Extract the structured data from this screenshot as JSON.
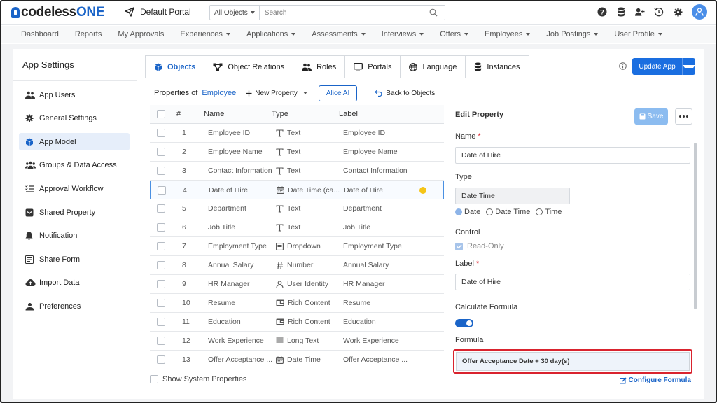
{
  "brand": {
    "prefix": "codeless",
    "suffix": "ONE"
  },
  "portal": {
    "name": "Default Portal"
  },
  "search": {
    "scope": "All Objects",
    "placeholder": "Search"
  },
  "topicons": [
    "help-icon",
    "database-icon",
    "user-add-icon",
    "history-icon",
    "gear-icon",
    "user-avatar-icon"
  ],
  "menu": [
    {
      "label": "Dashboard",
      "dropdown": false
    },
    {
      "label": "Reports",
      "dropdown": false
    },
    {
      "label": "My Approvals",
      "dropdown": false
    },
    {
      "label": "Experiences",
      "dropdown": true
    },
    {
      "label": "Applications",
      "dropdown": true
    },
    {
      "label": "Assessments",
      "dropdown": true
    },
    {
      "label": "Interviews",
      "dropdown": true
    },
    {
      "label": "Offers",
      "dropdown": true
    },
    {
      "label": "Employees",
      "dropdown": true
    },
    {
      "label": "Job Postings",
      "dropdown": true
    },
    {
      "label": "User Profile",
      "dropdown": true
    }
  ],
  "sidebar": {
    "title": "App Settings",
    "items": [
      {
        "label": "App Users",
        "icon": "users-icon"
      },
      {
        "label": "General Settings",
        "icon": "gear-icon"
      },
      {
        "label": "App Model",
        "icon": "cube-icon",
        "active": true
      },
      {
        "label": "Groups & Data Access",
        "icon": "group-icon"
      },
      {
        "label": "Approval Workflow",
        "icon": "checklist-icon"
      },
      {
        "label": "Shared Property",
        "icon": "shared-icon"
      },
      {
        "label": "Notification",
        "icon": "bell-icon"
      },
      {
        "label": "Share Form",
        "icon": "form-icon"
      },
      {
        "label": "Import Data",
        "icon": "cloud-upload-icon"
      },
      {
        "label": "Preferences",
        "icon": "preferences-icon"
      }
    ]
  },
  "tabs": [
    {
      "label": "Objects",
      "icon": "cube-icon",
      "active": true
    },
    {
      "label": "Object Relations",
      "icon": "relations-icon"
    },
    {
      "label": "Roles",
      "icon": "roles-icon"
    },
    {
      "label": "Portals",
      "icon": "monitor-icon"
    },
    {
      "label": "Language",
      "icon": "globe-icon"
    },
    {
      "label": "Instances",
      "icon": "database-icon"
    }
  ],
  "update_button": {
    "label": "Update App"
  },
  "properties": {
    "prefix": "Properties of",
    "object": "Employee",
    "new_property": "New Property",
    "alice": "Alice AI",
    "back": "Back to Objects"
  },
  "table": {
    "headers": {
      "num": "#",
      "name": "Name",
      "type": "Type",
      "label": "Label"
    },
    "rows": [
      {
        "num": "1",
        "name": "Employee ID",
        "type": "Text",
        "icon": "text-icon",
        "label": "Employee ID"
      },
      {
        "num": "2",
        "name": "Employee Name",
        "type": "Text",
        "icon": "text-icon",
        "label": "Employee Name"
      },
      {
        "num": "3",
        "name": "Contact Information",
        "type": "Text",
        "icon": "text-icon",
        "label": "Contact Information"
      },
      {
        "num": "4",
        "name": "Date of Hire",
        "type": "Date Time (ca...",
        "icon": "calendar-icon",
        "label": "Date of Hire",
        "selected": true
      },
      {
        "num": "5",
        "name": "Department",
        "type": "Text",
        "icon": "text-icon",
        "label": "Department"
      },
      {
        "num": "6",
        "name": "Job Title",
        "type": "Text",
        "icon": "text-icon",
        "label": "Job Title"
      },
      {
        "num": "7",
        "name": "Employment Type",
        "type": "Dropdown",
        "icon": "dropdown-icon",
        "label": "Employment Type"
      },
      {
        "num": "8",
        "name": "Annual Salary",
        "type": "Number",
        "icon": "hash-icon",
        "label": "Annual Salary"
      },
      {
        "num": "9",
        "name": "HR Manager",
        "type": "User Identity",
        "icon": "user-icon",
        "label": "HR Manager"
      },
      {
        "num": "10",
        "name": "Resume",
        "type": "Rich Content",
        "icon": "rich-content-icon",
        "label": "Resume"
      },
      {
        "num": "11",
        "name": "Education",
        "type": "Rich Content",
        "icon": "rich-content-icon",
        "label": "Education"
      },
      {
        "num": "12",
        "name": "Work Experience",
        "type": "Long Text",
        "icon": "long-text-icon",
        "label": "Work Experience"
      },
      {
        "num": "13",
        "name": "Offer Acceptance ...",
        "type": "Date Time",
        "icon": "calendar-icon",
        "label": "Offer Acceptance ..."
      }
    ],
    "show_system": "Show System Properties"
  },
  "edit": {
    "title": "Edit Property",
    "save": "Save",
    "name_label": "Name",
    "name_value": "Date of Hire",
    "type_label": "Type",
    "type_value": "Date Time",
    "radio": [
      {
        "label": "Date",
        "checked": true
      },
      {
        "label": "Date Time",
        "checked": false
      },
      {
        "label": "Time",
        "checked": false
      }
    ],
    "control_label": "Control",
    "readonly": "Read-Only",
    "label_label": "Label",
    "label_value": "Date of Hire",
    "calc_label": "Calculate Formula",
    "calc_on": true,
    "formula_label": "Formula",
    "formula_value": "Offer Acceptance Date + 30 day(s)",
    "configure": "Configure Formula"
  },
  "colors": {
    "accent": "#1a64c8",
    "highlight": "#d9232e",
    "dot": "#f5c518"
  }
}
